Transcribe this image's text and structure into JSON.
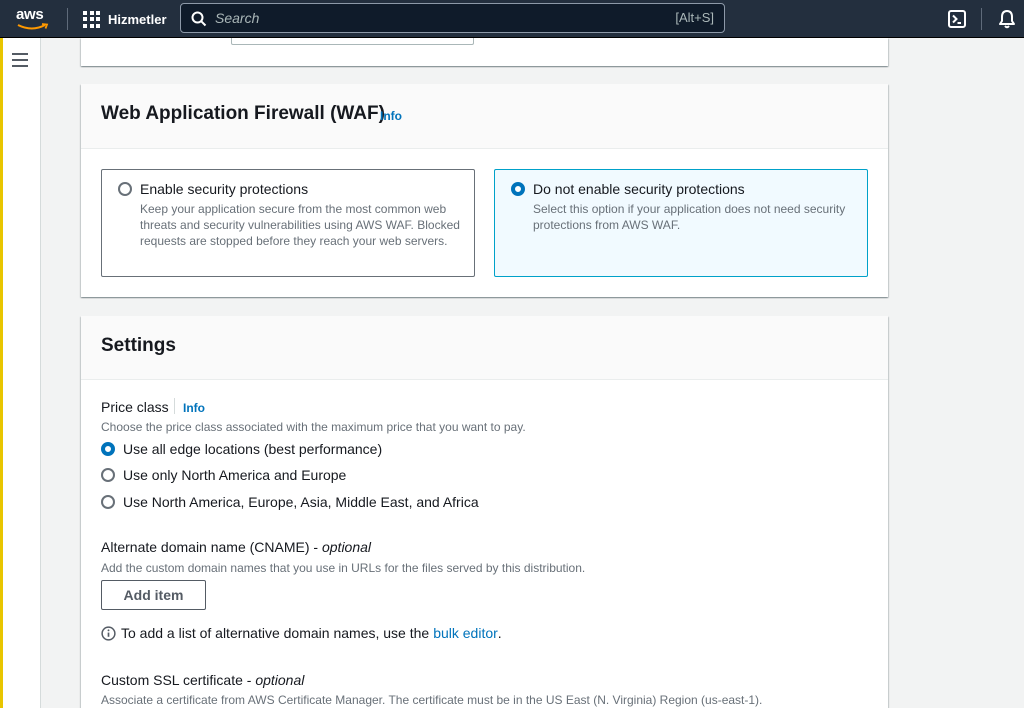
{
  "nav": {
    "logo_text": "aws",
    "services_label": "Hizmetler",
    "search_placeholder": "Search",
    "search_shortcut": "[Alt+S]"
  },
  "waf": {
    "title": "Web Application Firewall (WAF)",
    "info": "Info",
    "options": [
      {
        "title": "Enable security protections",
        "description": "Keep your application secure from the most common web threats and security vulnerabilities using AWS WAF. Blocked requests are stopped before they reach your web servers.",
        "selected": false
      },
      {
        "title": "Do not enable security protections",
        "description": "Select this option if your application does not need security protections from AWS WAF.",
        "selected": true
      }
    ]
  },
  "settings": {
    "title": "Settings",
    "price_class": {
      "label": "Price class",
      "info": "Info",
      "description": "Choose the price class associated with the maximum price that you want to pay.",
      "options": [
        {
          "label": "Use all edge locations (best performance)",
          "selected": true
        },
        {
          "label": "Use only North America and Europe",
          "selected": false
        },
        {
          "label": "Use North America, Europe, Asia, Middle East, and Africa",
          "selected": false
        }
      ]
    },
    "cname": {
      "label": "Alternate domain name (CNAME)",
      "optional": "optional",
      "description": "Add the custom domain names that you use in URLs for the files served by this distribution.",
      "add_button": "Add item",
      "note_prefix": "To add a list of alternative domain names, use the",
      "note_link": "bulk editor",
      "note_suffix": "."
    },
    "ssl": {
      "label": "Custom SSL certificate",
      "optional": "optional",
      "description": "Associate a certificate from AWS Certificate Manager. The certificate must be in the US East (N. Virginia) Region (us-east-1)."
    }
  },
  "colors": {
    "nav_bg": "#232f3e",
    "accent": "#0073bb",
    "selected_border": "#00a1c9",
    "selected_bg": "#f1faff",
    "aws_orange": "#ff9900"
  }
}
